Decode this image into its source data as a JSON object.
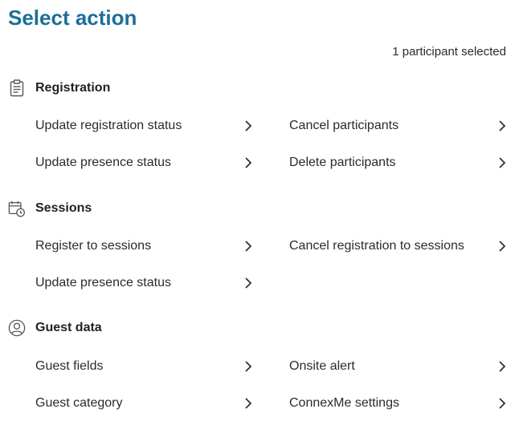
{
  "title": "Select action",
  "selection_status": "1 participant selected",
  "sections": {
    "registration": {
      "label": "Registration",
      "icon": "clipboard-icon",
      "actions": [
        "Update registration status",
        "Cancel participants",
        "Update presence status",
        "Delete participants"
      ]
    },
    "sessions": {
      "label": "Sessions",
      "icon": "calendar-clock-icon",
      "actions": [
        "Register to sessions",
        "Cancel registration to sessions",
        "Update presence status"
      ]
    },
    "guest_data": {
      "label": "Guest data",
      "icon": "user-circle-icon",
      "actions": [
        "Guest fields",
        "Onsite alert",
        "Guest category",
        "ConnexMe settings"
      ]
    }
  },
  "colors": {
    "title": "#1c6f9a",
    "text": "#2b2b2b"
  }
}
